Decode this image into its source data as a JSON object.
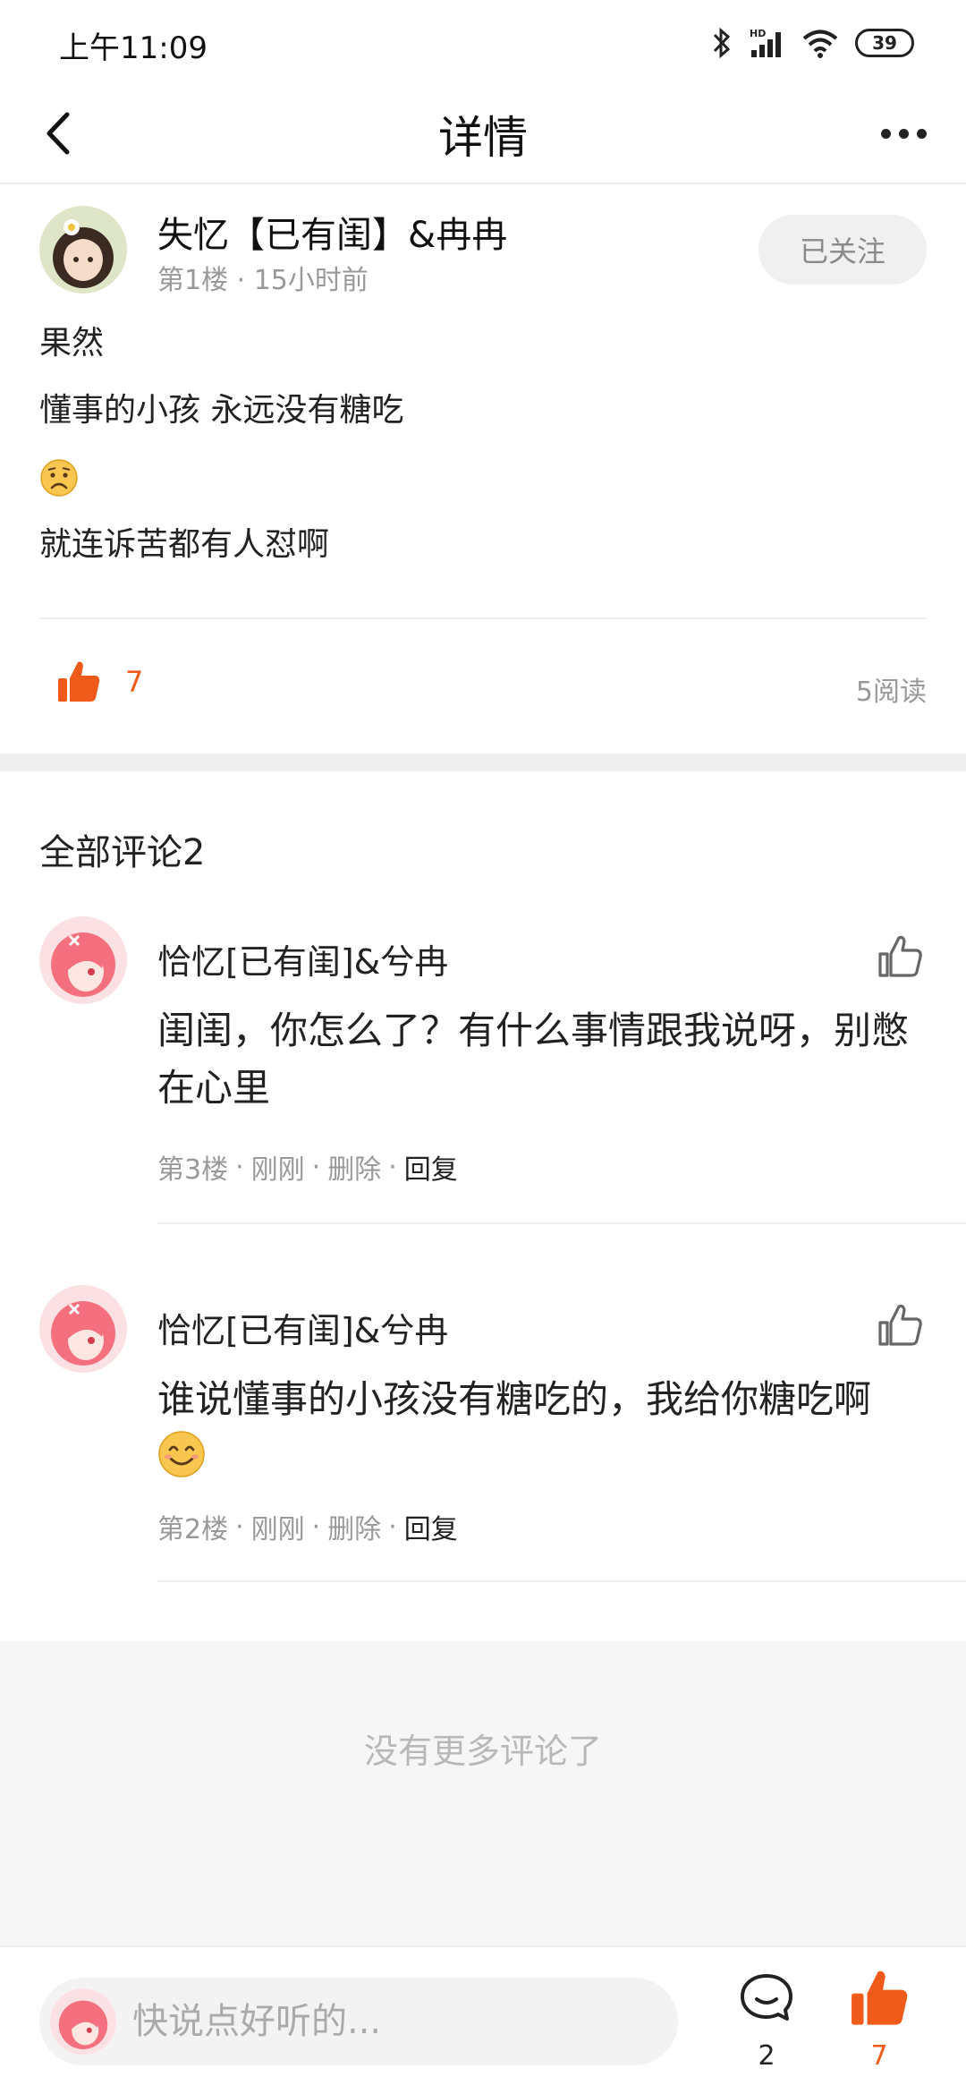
{
  "status": {
    "time": "上午11:09",
    "battery": "39"
  },
  "nav": {
    "title": "详情"
  },
  "post": {
    "author": "失忆【已有闺】&冉冉",
    "meta": "第1楼 · 15小时前",
    "follow_label": "已关注",
    "lines": [
      "果然",
      "懂事的小孩  永远没有糖吃",
      "就连诉苦都有人怼啊"
    ],
    "like_count": "7",
    "reads": "5阅读"
  },
  "comments_title": "全部评论2",
  "comments": [
    {
      "author": "恰忆[已有闺]&兮冉",
      "text": "闺闺，你怎么了？有什么事情跟我说呀，别憋在心里",
      "floor": "第3楼",
      "time": "刚刚",
      "delete_label": "删除",
      "reply_label": "回复"
    },
    {
      "author": "恰忆[已有闺]&兮冉",
      "text": "谁说懂事的小孩没有糖吃的，我给你糖吃啊",
      "floor": "第2楼",
      "time": "刚刚",
      "delete_label": "删除",
      "reply_label": "回复"
    }
  ],
  "no_more_text": "没有更多评论了",
  "bottom_bar": {
    "input_placeholder": "快说点好听的...",
    "comment_count": "2",
    "like_count": "7"
  },
  "colors": {
    "accent": "#f05a1a",
    "muted": "#999999"
  }
}
